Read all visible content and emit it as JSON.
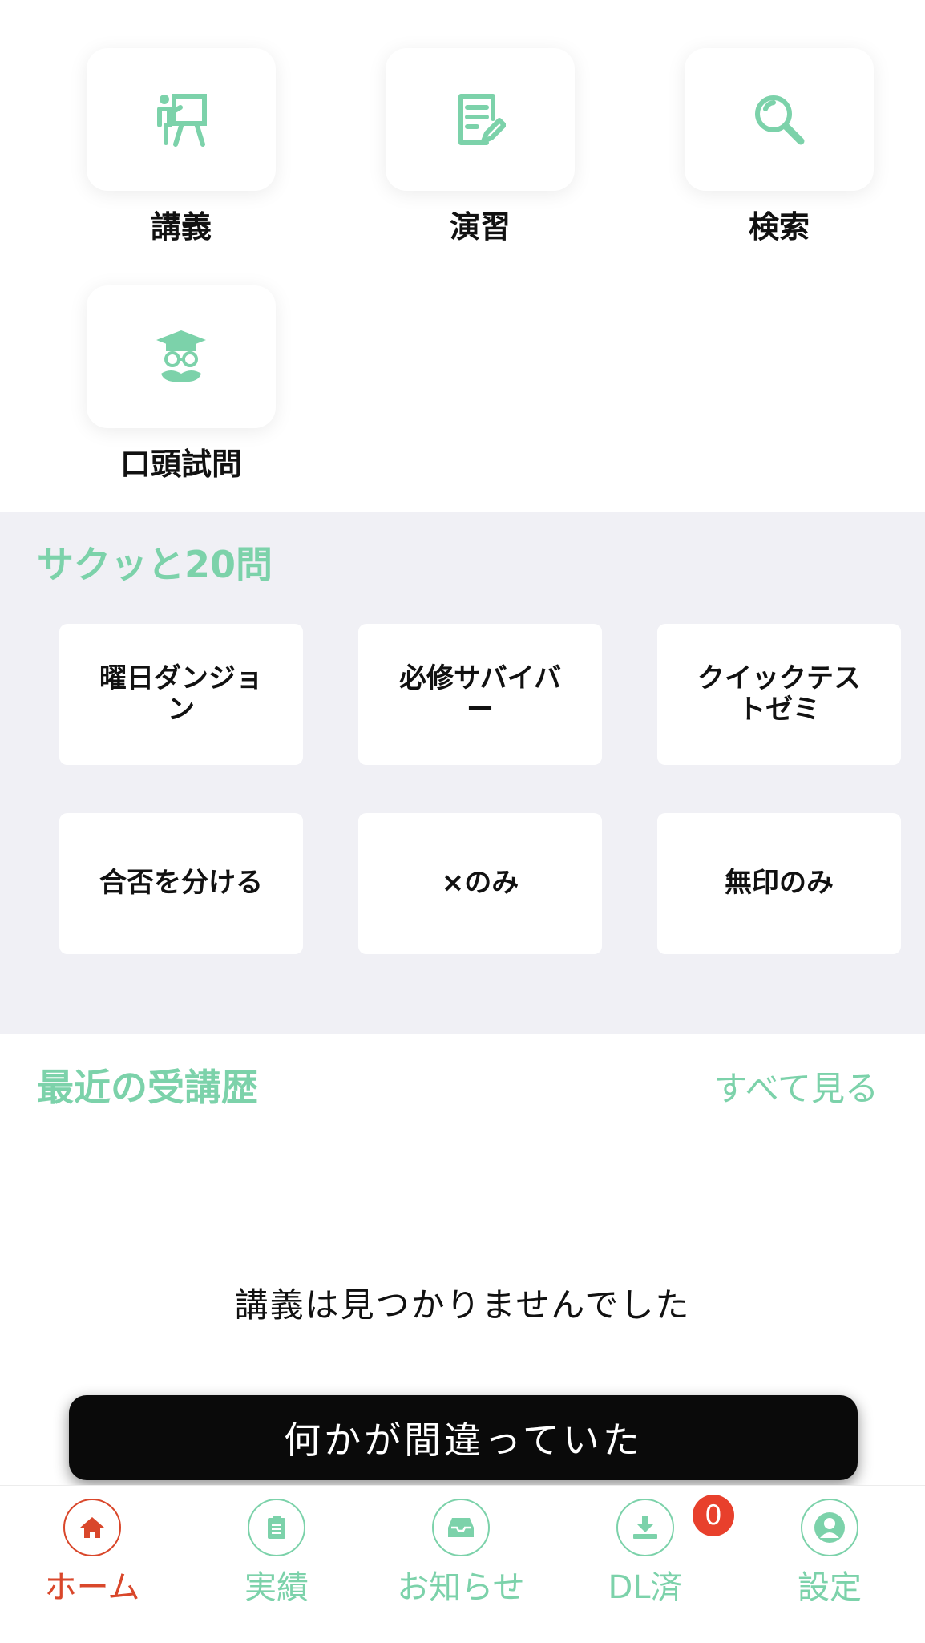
{
  "colors": {
    "accent": "#7cd2aa",
    "active": "#d9472b",
    "badge": "#e8402c"
  },
  "menu": [
    {
      "label": "講義",
      "icon": "lecture-presenter-icon"
    },
    {
      "label": "演習",
      "icon": "exercise-edit-icon"
    },
    {
      "label": "検索",
      "icon": "search-icon"
    },
    {
      "label": "口頭試問",
      "icon": "professor-graduate-icon"
    }
  ],
  "quick": {
    "title": "サクッと20問",
    "buttons": [
      "曜日ダンジョン",
      "必修サバイバー",
      "クイックテストゼミ",
      "合否を分ける",
      "×のみ",
      "無印のみ"
    ]
  },
  "recent": {
    "title": "最近の受講歴",
    "see_all": "すべて見る",
    "empty": "講義は見つかりませんでした"
  },
  "toast": "何かが間違っていた",
  "tabs": [
    {
      "label": "ホーム",
      "icon": "home-icon",
      "active": true
    },
    {
      "label": "実績",
      "icon": "clipboard-icon",
      "active": false
    },
    {
      "label": "お知らせ",
      "icon": "inbox-icon",
      "active": false
    },
    {
      "label": "DL済",
      "icon": "download-icon",
      "active": false,
      "badge": "0"
    },
    {
      "label": "設定",
      "icon": "user-icon",
      "active": false
    }
  ]
}
